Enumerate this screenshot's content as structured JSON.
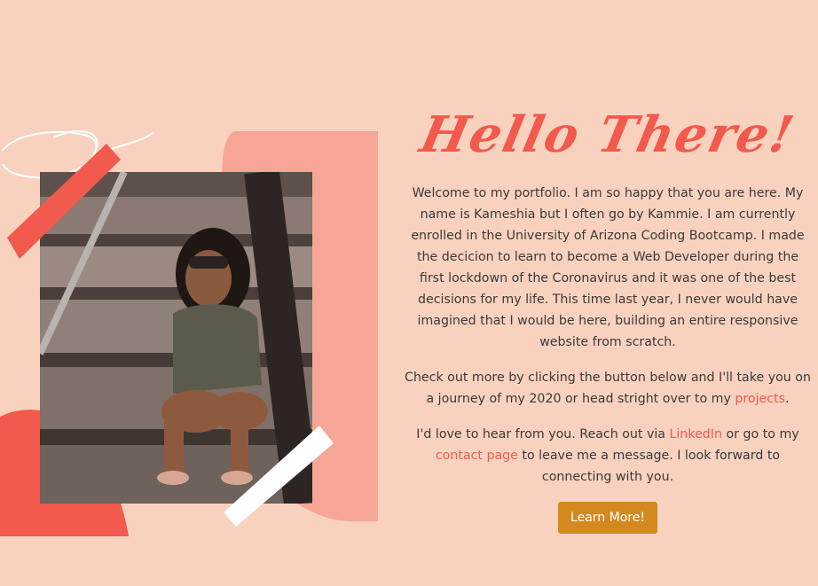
{
  "hero": {
    "title": "Hello There!",
    "intro": "Welcome to my portfolio. I am so happy that you are here. My name is Kameshia but I often go by Kammie. I am currently enrolled in the University of Arizona Coding Bootcamp. I made the decicion to learn to become a Web Developer during the first lockdown of the Coronavirus and it was one of the best decisions for my life. This time last year, I never would have imagined that I would be here, building an entire responsive website from scratch.",
    "projects_prefix": "Check out more by clicking the button below and I'll take you on a journey of my 2020 or head stright over to my ",
    "projects_link": "projects",
    "projects_suffix": ".",
    "contact_prefix": "I'd love to hear from you. Reach out via ",
    "linkedin_link": "LinkedIn",
    "contact_middle": " or go to my ",
    "contact_link": "contact page",
    "contact_suffix": " to leave me a message. I look forward to connecting with you.",
    "button_label": "Learn More!"
  },
  "colors": {
    "background": "#f9d2bf",
    "accent": "#f25a4d",
    "salmon": "#f7a597",
    "button": "#d4891f"
  },
  "icons": [
    "profile-photo"
  ]
}
